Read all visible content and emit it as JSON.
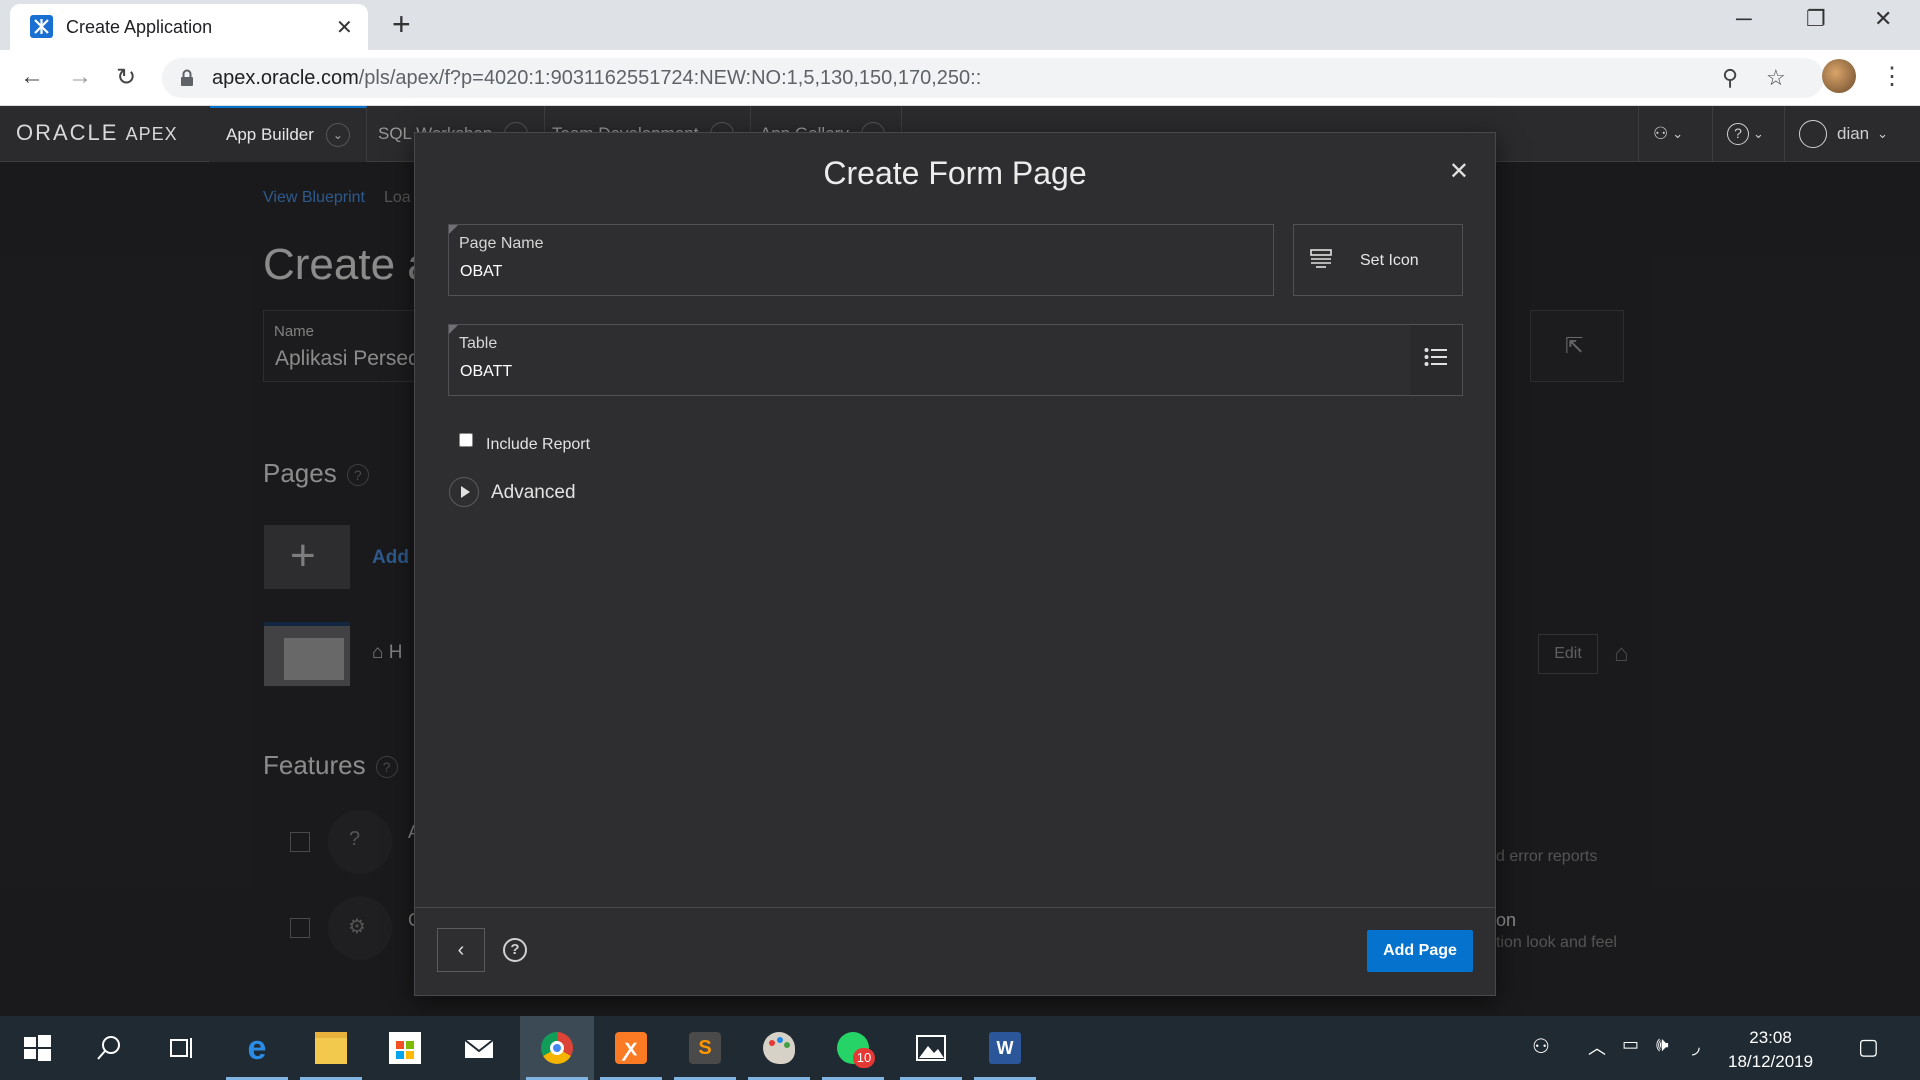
{
  "browser": {
    "tab_title": "Create Application",
    "url_host": "apex.oracle.com",
    "url_path": "/pls/apex/f?p=4020:1:9031162551724:NEW:NO:1,5,130,150,170,250::"
  },
  "apex": {
    "logo_oracle": "ORACLE",
    "logo_apex": "APEX",
    "nav": [
      "App Builder",
      "SQL Workshop",
      "Team Development",
      "App Gallery"
    ],
    "user": "dian"
  },
  "background": {
    "view_blueprint": "View Blueprint",
    "load_partial": "Loa",
    "page_title": "Create a",
    "name_label": "Name",
    "name_value": "Aplikasi Persec",
    "pages_heading": "Pages",
    "add_label": "Add",
    "home_label": "H",
    "edit_label": "Edit",
    "features_heading": "Features",
    "feature1_a": "A",
    "feature2_a": "C",
    "right_text1": "d error reports",
    "right_text2": "on",
    "right_text3": "tion look and feel"
  },
  "dialog": {
    "title": "Create Form Page",
    "page_name_label": "Page Name",
    "page_name_value": "OBAT",
    "set_icon_label": "Set Icon",
    "table_label": "Table",
    "table_value": "OBATT",
    "include_report_label": "Include Report",
    "include_report_checked": false,
    "advanced_label": "Advanced",
    "add_page_label": "Add Page"
  },
  "taskbar": {
    "whatsapp_badge": "10",
    "time": "23:08",
    "date": "18/12/2019"
  },
  "colors": {
    "accent": "#0572ce",
    "header_bg": "#2b2b2e",
    "dialog_bg": "#2e2e31"
  }
}
